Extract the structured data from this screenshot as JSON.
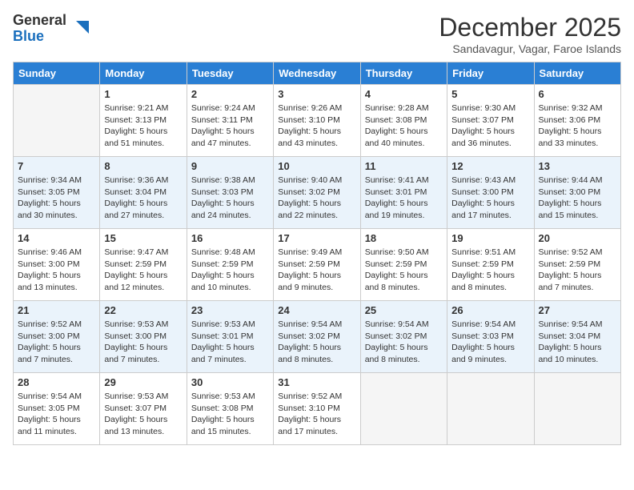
{
  "logo": {
    "general": "General",
    "blue": "Blue"
  },
  "title": "December 2025",
  "location": "Sandavagur, Vagar, Faroe Islands",
  "weekdays": [
    "Sunday",
    "Monday",
    "Tuesday",
    "Wednesday",
    "Thursday",
    "Friday",
    "Saturday"
  ],
  "weeks": [
    [
      {
        "num": "",
        "sunrise": "",
        "sunset": "",
        "daylight": "",
        "empty": true
      },
      {
        "num": "1",
        "sunrise": "Sunrise: 9:21 AM",
        "sunset": "Sunset: 3:13 PM",
        "daylight": "Daylight: 5 hours and 51 minutes."
      },
      {
        "num": "2",
        "sunrise": "Sunrise: 9:24 AM",
        "sunset": "Sunset: 3:11 PM",
        "daylight": "Daylight: 5 hours and 47 minutes."
      },
      {
        "num": "3",
        "sunrise": "Sunrise: 9:26 AM",
        "sunset": "Sunset: 3:10 PM",
        "daylight": "Daylight: 5 hours and 43 minutes."
      },
      {
        "num": "4",
        "sunrise": "Sunrise: 9:28 AM",
        "sunset": "Sunset: 3:08 PM",
        "daylight": "Daylight: 5 hours and 40 minutes."
      },
      {
        "num": "5",
        "sunrise": "Sunrise: 9:30 AM",
        "sunset": "Sunset: 3:07 PM",
        "daylight": "Daylight: 5 hours and 36 minutes."
      },
      {
        "num": "6",
        "sunrise": "Sunrise: 9:32 AM",
        "sunset": "Sunset: 3:06 PM",
        "daylight": "Daylight: 5 hours and 33 minutes."
      }
    ],
    [
      {
        "num": "7",
        "sunrise": "Sunrise: 9:34 AM",
        "sunset": "Sunset: 3:05 PM",
        "daylight": "Daylight: 5 hours and 30 minutes."
      },
      {
        "num": "8",
        "sunrise": "Sunrise: 9:36 AM",
        "sunset": "Sunset: 3:04 PM",
        "daylight": "Daylight: 5 hours and 27 minutes."
      },
      {
        "num": "9",
        "sunrise": "Sunrise: 9:38 AM",
        "sunset": "Sunset: 3:03 PM",
        "daylight": "Daylight: 5 hours and 24 minutes."
      },
      {
        "num": "10",
        "sunrise": "Sunrise: 9:40 AM",
        "sunset": "Sunset: 3:02 PM",
        "daylight": "Daylight: 5 hours and 22 minutes."
      },
      {
        "num": "11",
        "sunrise": "Sunrise: 9:41 AM",
        "sunset": "Sunset: 3:01 PM",
        "daylight": "Daylight: 5 hours and 19 minutes."
      },
      {
        "num": "12",
        "sunrise": "Sunrise: 9:43 AM",
        "sunset": "Sunset: 3:00 PM",
        "daylight": "Daylight: 5 hours and 17 minutes."
      },
      {
        "num": "13",
        "sunrise": "Sunrise: 9:44 AM",
        "sunset": "Sunset: 3:00 PM",
        "daylight": "Daylight: 5 hours and 15 minutes."
      }
    ],
    [
      {
        "num": "14",
        "sunrise": "Sunrise: 9:46 AM",
        "sunset": "Sunset: 3:00 PM",
        "daylight": "Daylight: 5 hours and 13 minutes."
      },
      {
        "num": "15",
        "sunrise": "Sunrise: 9:47 AM",
        "sunset": "Sunset: 2:59 PM",
        "daylight": "Daylight: 5 hours and 12 minutes."
      },
      {
        "num": "16",
        "sunrise": "Sunrise: 9:48 AM",
        "sunset": "Sunset: 2:59 PM",
        "daylight": "Daylight: 5 hours and 10 minutes."
      },
      {
        "num": "17",
        "sunrise": "Sunrise: 9:49 AM",
        "sunset": "Sunset: 2:59 PM",
        "daylight": "Daylight: 5 hours and 9 minutes."
      },
      {
        "num": "18",
        "sunrise": "Sunrise: 9:50 AM",
        "sunset": "Sunset: 2:59 PM",
        "daylight": "Daylight: 5 hours and 8 minutes."
      },
      {
        "num": "19",
        "sunrise": "Sunrise: 9:51 AM",
        "sunset": "Sunset: 2:59 PM",
        "daylight": "Daylight: 5 hours and 8 minutes."
      },
      {
        "num": "20",
        "sunrise": "Sunrise: 9:52 AM",
        "sunset": "Sunset: 2:59 PM",
        "daylight": "Daylight: 5 hours and 7 minutes."
      }
    ],
    [
      {
        "num": "21",
        "sunrise": "Sunrise: 9:52 AM",
        "sunset": "Sunset: 3:00 PM",
        "daylight": "Daylight: 5 hours and 7 minutes."
      },
      {
        "num": "22",
        "sunrise": "Sunrise: 9:53 AM",
        "sunset": "Sunset: 3:00 PM",
        "daylight": "Daylight: 5 hours and 7 minutes."
      },
      {
        "num": "23",
        "sunrise": "Sunrise: 9:53 AM",
        "sunset": "Sunset: 3:01 PM",
        "daylight": "Daylight: 5 hours and 7 minutes."
      },
      {
        "num": "24",
        "sunrise": "Sunrise: 9:54 AM",
        "sunset": "Sunset: 3:02 PM",
        "daylight": "Daylight: 5 hours and 8 minutes."
      },
      {
        "num": "25",
        "sunrise": "Sunrise: 9:54 AM",
        "sunset": "Sunset: 3:02 PM",
        "daylight": "Daylight: 5 hours and 8 minutes."
      },
      {
        "num": "26",
        "sunrise": "Sunrise: 9:54 AM",
        "sunset": "Sunset: 3:03 PM",
        "daylight": "Daylight: 5 hours and 9 minutes."
      },
      {
        "num": "27",
        "sunrise": "Sunrise: 9:54 AM",
        "sunset": "Sunset: 3:04 PM",
        "daylight": "Daylight: 5 hours and 10 minutes."
      }
    ],
    [
      {
        "num": "28",
        "sunrise": "Sunrise: 9:54 AM",
        "sunset": "Sunset: 3:05 PM",
        "daylight": "Daylight: 5 hours and 11 minutes."
      },
      {
        "num": "29",
        "sunrise": "Sunrise: 9:53 AM",
        "sunset": "Sunset: 3:07 PM",
        "daylight": "Daylight: 5 hours and 13 minutes."
      },
      {
        "num": "30",
        "sunrise": "Sunrise: 9:53 AM",
        "sunset": "Sunset: 3:08 PM",
        "daylight": "Daylight: 5 hours and 15 minutes."
      },
      {
        "num": "31",
        "sunrise": "Sunrise: 9:52 AM",
        "sunset": "Sunset: 3:10 PM",
        "daylight": "Daylight: 5 hours and 17 minutes."
      },
      {
        "num": "",
        "sunrise": "",
        "sunset": "",
        "daylight": "",
        "empty": true
      },
      {
        "num": "",
        "sunrise": "",
        "sunset": "",
        "daylight": "",
        "empty": true
      },
      {
        "num": "",
        "sunrise": "",
        "sunset": "",
        "daylight": "",
        "empty": true
      }
    ]
  ]
}
